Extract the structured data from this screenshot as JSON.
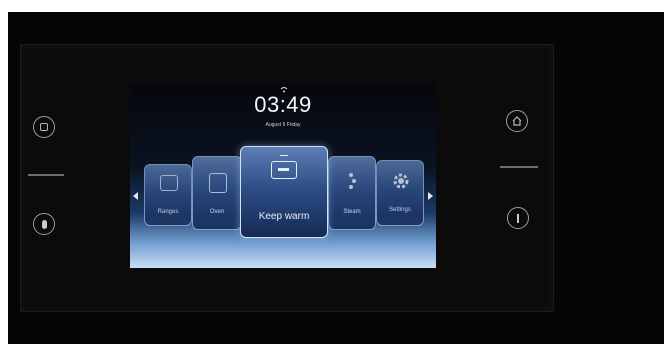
{
  "status": {
    "wifi_icon": "wifi-icon"
  },
  "clock": {
    "time": "03:49",
    "date": "August  9 Friday"
  },
  "carousel": {
    "items": [
      {
        "label": "Ranges",
        "icon": "tray-icon"
      },
      {
        "label": "Oven",
        "icon": "oven-icon"
      },
      {
        "label": "Keep warm",
        "icon": "keep-warm-icon",
        "selected": true
      },
      {
        "label": "Steam",
        "icon": "steam-icon"
      },
      {
        "label": "Settings",
        "icon": "settings-gear-icon"
      }
    ]
  },
  "side_buttons": {
    "left_top": "stop-icon",
    "left_bottom": "temperature-icon",
    "right_top": "home-icon",
    "right_bottom": "power-icon"
  }
}
